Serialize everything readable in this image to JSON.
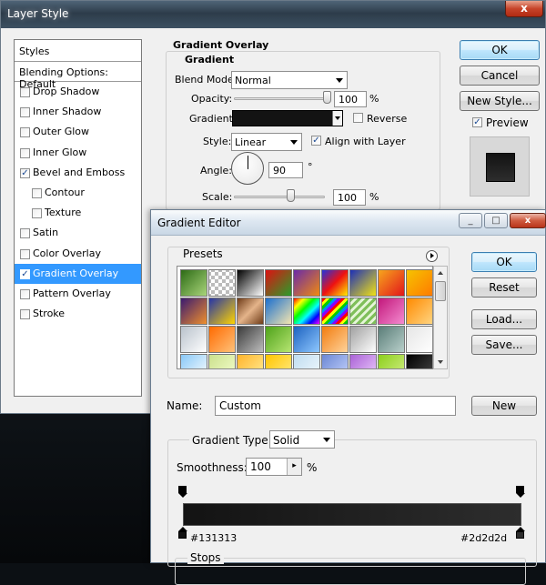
{
  "layer_style": {
    "window_title": "Layer Style",
    "styles_header": "Styles",
    "blending_default": "Blending Options: Default",
    "items": [
      {
        "label": "Drop Shadow",
        "checked": false
      },
      {
        "label": "Inner Shadow",
        "checked": false
      },
      {
        "label": "Outer Glow",
        "checked": false
      },
      {
        "label": "Inner Glow",
        "checked": false
      },
      {
        "label": "Bevel and Emboss",
        "checked": true
      },
      {
        "label": "Contour",
        "checked": false
      },
      {
        "label": "Texture",
        "checked": false
      },
      {
        "label": "Satin",
        "checked": false
      },
      {
        "label": "Color Overlay",
        "checked": false
      },
      {
        "label": "Gradient Overlay",
        "checked": true
      },
      {
        "label": "Pattern Overlay",
        "checked": false
      },
      {
        "label": "Stroke",
        "checked": false
      }
    ],
    "section_title": "Gradient Overlay",
    "group_title": "Gradient",
    "blend_mode_label": "Blend Mode:",
    "blend_mode_value": "Normal",
    "opacity_label": "Opacity:",
    "opacity_value": "100",
    "opacity_unit": "%",
    "opacity_level": 1.0,
    "gradient_label": "Gradient:",
    "reverse_label": "Reverse",
    "style_label": "Style:",
    "style_value": "Linear",
    "align_label": "Align with Layer",
    "angle_label": "Angle:",
    "angle_value": "90",
    "angle_unit": "°",
    "scale_label": "Scale:",
    "scale_value": "100",
    "scale_unit": "%",
    "scale_level": 0.5,
    "ok_label": "OK",
    "cancel_label": "Cancel",
    "new_style_label": "New Style...",
    "preview_label": "Preview",
    "close_glyph": "x"
  },
  "gradient_editor": {
    "window_title": "Gradient Editor",
    "presets_label": "Presets",
    "ok_label": "OK",
    "reset_label": "Reset",
    "load_label": "Load...",
    "save_label": "Save...",
    "name_label": "Name:",
    "name_value": "Custom",
    "new_label": "New",
    "gradient_type_label": "Gradient Type:",
    "gradient_type_value": "Solid",
    "smoothness_label": "Smoothness:",
    "smoothness_value": "100",
    "smoothness_unit": "%",
    "start_color_label": "#131313",
    "end_color_label": "#2d2d2d",
    "stops_label": "Stops",
    "minimize_glyph": "_",
    "maximize_glyph": "□",
    "close_glyph": "x"
  },
  "colors": {
    "gradient_start": "#131313",
    "gradient_end": "#2d2d2d",
    "selection": "#3399ff"
  },
  "presets": [
    [
      "linear-gradient(135deg,#2d6b16,#a9d57a)",
      "checker-gray",
      "linear-gradient(135deg,#000,#fff)",
      "linear-gradient(135deg,#d11,#2a9d2a)",
      "linear-gradient(135deg,#6a2aa8,#f08a10)",
      "linear-gradient(135deg,#2233dd,#ee1111,#ffee00)",
      "linear-gradient(135deg,#1c2fb8,#f2e313)",
      "linear-gradient(135deg,#f7a51c,#e2161b)",
      "linear-gradient(135deg,#f6c300,#ff7b00)"
    ],
    [
      "linear-gradient(135deg,#3a1a70,#ef8f2c)",
      "linear-gradient(135deg,#2434a8,#ffd400)",
      "linear-gradient(135deg,#6e3b18,#e4b48a,#6e3b18)",
      "linear-gradient(135deg,#1b6fcf,#f4e6b0)",
      "linear-gradient(135deg,#f00,#ff0,#0f0,#0ff,#00f,#f0f)",
      "stripes-rainbow",
      "stripes-green",
      "linear-gradient(135deg,#c2187b,#f48ad0)",
      "linear-gradient(135deg,#ff8a00,#ffd480)"
    ],
    [
      "linear-gradient(135deg,#b9c2cc,#ffffff)",
      "linear-gradient(135deg,#ff6a00,#ffc27a)",
      "linear-gradient(135deg,#3a3a3a,#bdbdbd)",
      "linear-gradient(135deg,#4ea21a,#b7e572)",
      "linear-gradient(135deg,#1d62c0,#8ec8ff)",
      "linear-gradient(135deg,#f27c0f,#ffd39a)",
      "linear-gradient(135deg,#a0a0a0,#ffffff)",
      "linear-gradient(135deg,#5a7d78,#b9d0cb)",
      "linear-gradient(135deg,#e5e5e5,#ffffff)"
    ],
    [
      "linear-gradient(135deg,#88c8f7,#ffffff)",
      "linear-gradient(135deg,#cbe08c,#f5ffd0)",
      "linear-gradient(135deg,#ffb32b,#fff09a)",
      "linear-gradient(135deg,#ffc400,#ffee8a)",
      "linear-gradient(135deg,#bfdcf0,#f4fbff)",
      "linear-gradient(135deg,#6b87d4,#c9d6ff)",
      "linear-gradient(135deg,#aa62d6,#efd0ff)",
      "linear-gradient(135deg,#8ccf1d,#d6f08a)",
      "linear-gradient(135deg,#000,#4a4a4a)"
    ]
  ]
}
